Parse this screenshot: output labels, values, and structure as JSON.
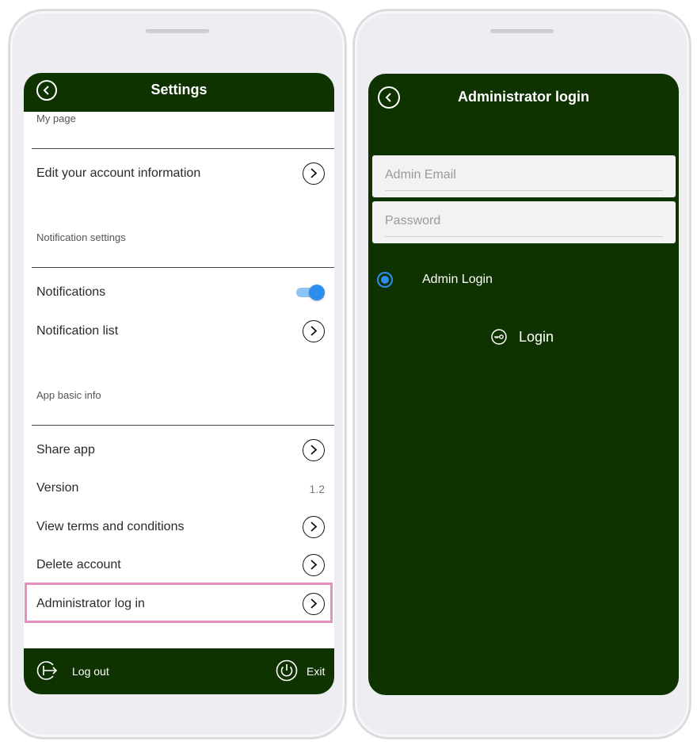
{
  "left_screen": {
    "title": "Settings",
    "sections": {
      "my_page": "My page",
      "notification_settings": "Notification settings",
      "app_basic_info": "App basic info"
    },
    "rows": {
      "edit_account": "Edit your account information",
      "notifications": "Notifications",
      "notification_list": "Notification list",
      "share_app": "Share app",
      "version": "Version",
      "version_value": "1.2",
      "view_terms": "View terms and conditions",
      "delete_account": "Delete account",
      "admin_login": "Administrator log in"
    },
    "notifications_enabled": true,
    "bottom_bar": {
      "logout": "Log out",
      "exit": "Exit"
    }
  },
  "right_screen": {
    "title": "Administrator login",
    "email_placeholder": "Admin Email",
    "password_placeholder": "Password",
    "radio_label": "Admin Login",
    "radio_selected": true,
    "login_button": "Login"
  },
  "colors": {
    "header_green": "#0f3300",
    "accent_blue": "#2e8ef0",
    "highlight_pink": "#e690c0"
  }
}
